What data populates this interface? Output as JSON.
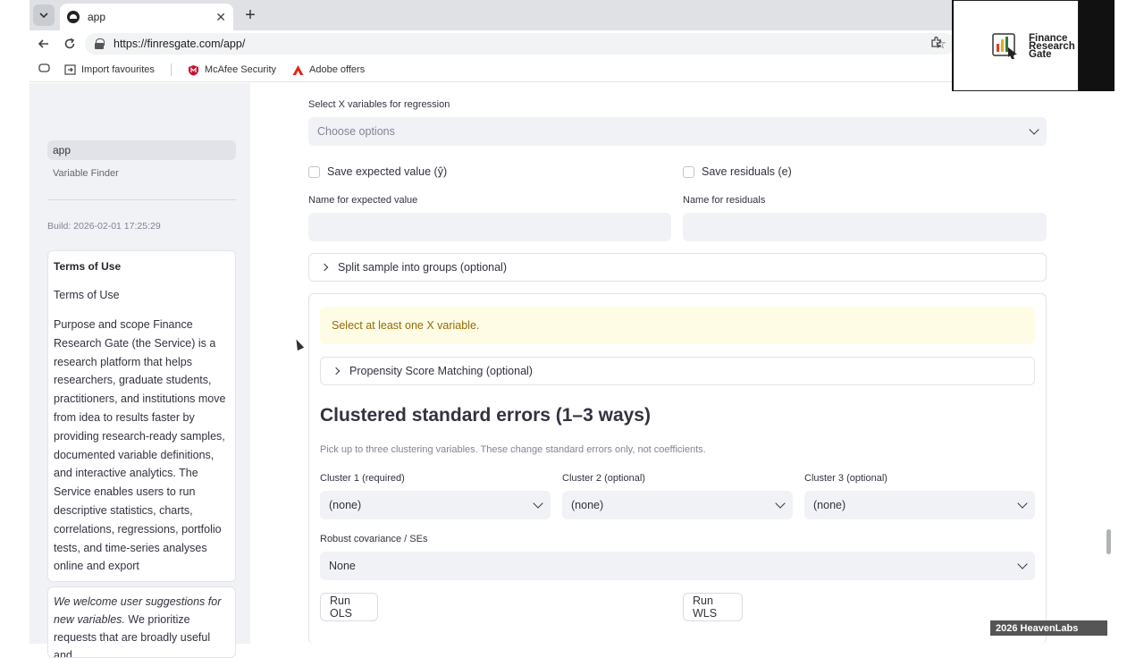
{
  "browser": {
    "tab_title": "app",
    "url": "https://finresgate.com/app/",
    "bookmarks": [
      "Import favourites",
      "McAfee Security",
      "Adobe offers"
    ]
  },
  "logo": {
    "line1": "Finance",
    "line2": "Research",
    "line3": "Gate"
  },
  "sidebar": {
    "nav": [
      {
        "label": "app",
        "active": true
      },
      {
        "label": "Variable Finder",
        "active": false
      }
    ],
    "build": "Build: 2026-02-01 17:25:29",
    "terms_title": "Terms of Use",
    "terms_subtitle": "Terms of Use",
    "terms_body": "Purpose and scope Finance Research Gate (the Service) is a research platform that helps researchers, graduate students, practitioners, and institutions move from idea to results faster by providing research-ready samples, documented variable definitions, and interactive analytics. The Service enables users to run descriptive statistics, charts, correlations, regressions, portfolio tests, and time-series analyses online and export",
    "suggest_italic": "We welcome user suggestions for new variables.",
    "suggest_rest": " We prioritize requests that are broadly useful and"
  },
  "main": {
    "x_vars_label": "Select X variables for regression",
    "x_vars_placeholder": "Choose options",
    "save_expected_label": "Save expected value (ŷ)",
    "save_residuals_label": "Save residuals (e)",
    "name_expected_label": "Name for expected value",
    "name_residuals_label": "Name for residuals",
    "split_sample_label": "Split sample into groups (optional)",
    "warning": "Select at least one X variable.",
    "psm_label": "Propensity Score Matching (optional)",
    "cluster_heading": "Clustered standard errors (1–3 ways)",
    "cluster_caption": "Pick up to three clustering variables. These change standard errors only, not coefficients.",
    "cluster1_label": "Cluster 1 (required)",
    "cluster2_label": "Cluster 2 (optional)",
    "cluster3_label": "Cluster 3 (optional)",
    "cluster1_value": "(none)",
    "cluster2_value": "(none)",
    "cluster3_value": "(none)",
    "robust_label": "Robust covariance / SEs",
    "robust_value": "None",
    "run_ols": "Run OLS",
    "run_wls": "Run WLS"
  },
  "watermark": "2026 HeavenLabs",
  "colors": {
    "sidebar_bg": "#f0f2f6",
    "warning_bg": "#fffce6",
    "warning_text": "#926c05",
    "input_bg": "#f0f2f6"
  }
}
